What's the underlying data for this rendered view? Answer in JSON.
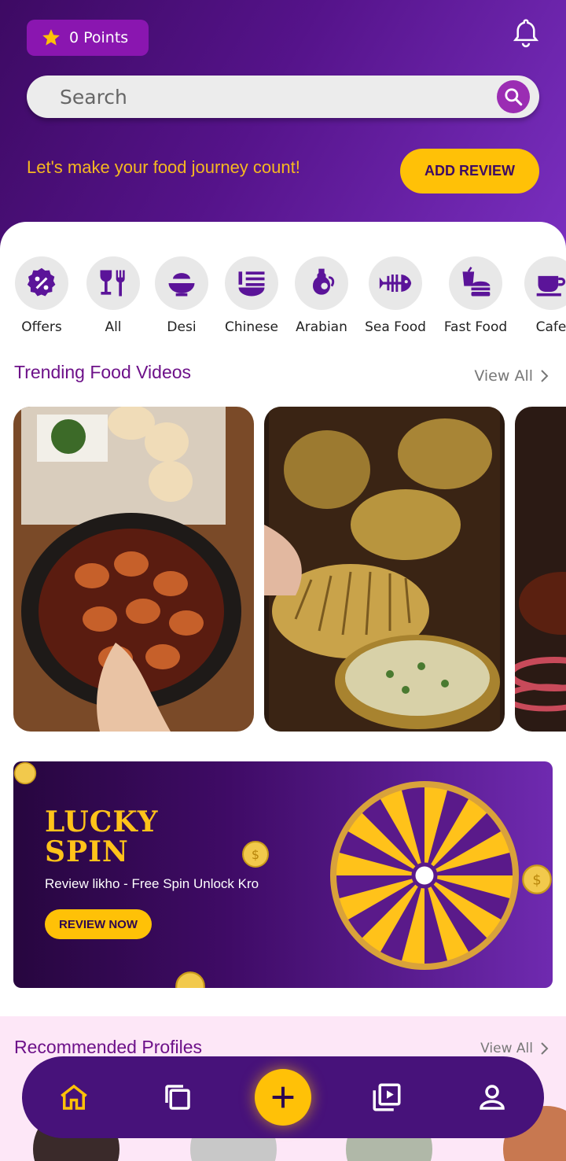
{
  "header": {
    "points_label": "0 Points",
    "search_placeholder": "Search",
    "tagline": "Let's make your food journey count!",
    "add_review_label": "ADD REVIEW"
  },
  "categories": [
    {
      "label": "Offers",
      "icon": "percent-badge-icon"
    },
    {
      "label": "All",
      "icon": "glass-fork-icon"
    },
    {
      "label": "Desi",
      "icon": "bowl-icon"
    },
    {
      "label": "Chinese",
      "icon": "noodles-icon"
    },
    {
      "label": "Arabian",
      "icon": "jug-icon"
    },
    {
      "label": "Sea Food",
      "icon": "fish-bone-icon"
    },
    {
      "label": "Fast Food",
      "icon": "burger-drink-icon"
    },
    {
      "label": "Cafe",
      "icon": "coffee-cup-icon"
    }
  ],
  "trending": {
    "title": "Trending Food Videos",
    "view_all": "View All"
  },
  "banner": {
    "title_line1": "LUCKY",
    "title_line2": "SPIN",
    "subtitle": "Review likho - Free Spin Unlock Kro",
    "button_label": "REVIEW NOW"
  },
  "recommended": {
    "title": "Recommended Profiles",
    "view_all": "View All"
  },
  "bottom_nav": {
    "items": [
      "home-icon",
      "copy-icon",
      "add-icon",
      "video-library-icon",
      "profile-icon"
    ]
  },
  "colors": {
    "brand_purple": "#55138a",
    "accent_yellow": "#ffc107",
    "title_purple": "#6d1189"
  }
}
